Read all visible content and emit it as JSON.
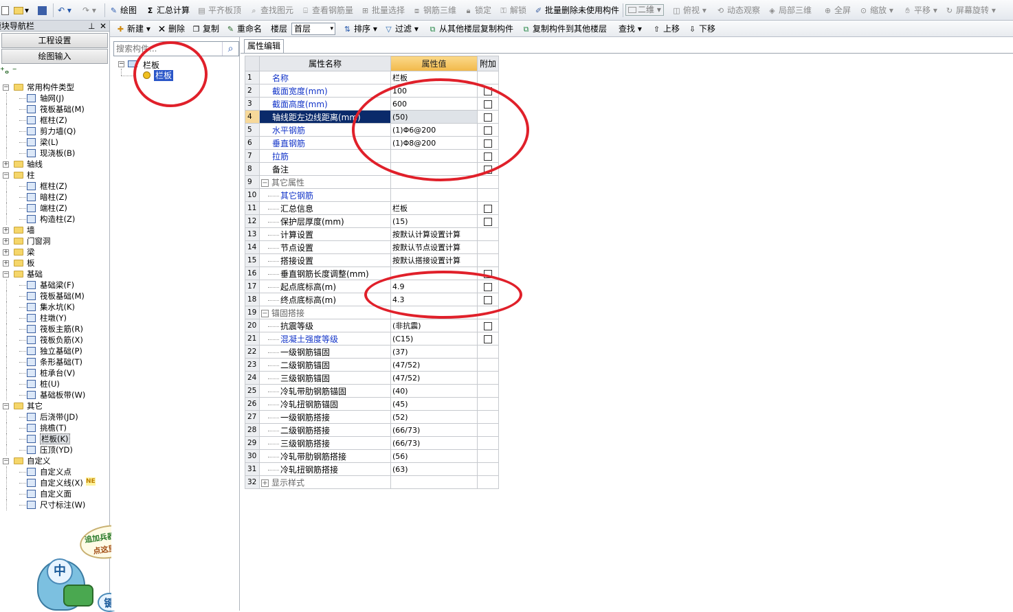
{
  "toolbar": {
    "draw": "绘图",
    "sum_calc": "汇总计算",
    "align_top": "平齐板顶",
    "find_element": "查找图元",
    "view_rebar": "查看钢筋量",
    "batch_select": "批量选择",
    "rebar_3d": "钢筋三维",
    "lock": "锁定",
    "unlock": "解锁",
    "batch_delete": "批量删除未使用构件",
    "view_mode": "二维",
    "top_view": "俯视",
    "dynamic_view": "动态观察",
    "local_3d": "局部三维",
    "fullscreen": "全屏",
    "zoom": "缩放",
    "pan": "平移",
    "rotate": "屏幕旋转"
  },
  "nav": {
    "title": "模块导航栏",
    "btn_project": "工程设置",
    "btn_draw": "绘图输入"
  },
  "tree": [
    {
      "label": "常用构件类型",
      "level": 0,
      "exp": "minus"
    },
    {
      "label": "轴网(J)",
      "level": 1
    },
    {
      "label": "筏板基础(M)",
      "level": 1
    },
    {
      "label": "框柱(Z)",
      "level": 1
    },
    {
      "label": "剪力墙(Q)",
      "level": 1
    },
    {
      "label": "梁(L)",
      "level": 1
    },
    {
      "label": "现浇板(B)",
      "level": 1
    },
    {
      "label": "轴线",
      "level": 0,
      "exp": "plus"
    },
    {
      "label": "柱",
      "level": 0,
      "exp": "minus"
    },
    {
      "label": "框柱(Z)",
      "level": 1
    },
    {
      "label": "暗柱(Z)",
      "level": 1
    },
    {
      "label": "端柱(Z)",
      "level": 1
    },
    {
      "label": "构造柱(Z)",
      "level": 1
    },
    {
      "label": "墙",
      "level": 0,
      "exp": "plus"
    },
    {
      "label": "门窗洞",
      "level": 0,
      "exp": "plus"
    },
    {
      "label": "梁",
      "level": 0,
      "exp": "plus"
    },
    {
      "label": "板",
      "level": 0,
      "exp": "plus"
    },
    {
      "label": "基础",
      "level": 0,
      "exp": "minus"
    },
    {
      "label": "基础梁(F)",
      "level": 1
    },
    {
      "label": "筏板基础(M)",
      "level": 1
    },
    {
      "label": "集水坑(K)",
      "level": 1
    },
    {
      "label": "柱墩(Y)",
      "level": 1
    },
    {
      "label": "筏板主筋(R)",
      "level": 1
    },
    {
      "label": "筏板负筋(X)",
      "level": 1
    },
    {
      "label": "独立基础(P)",
      "level": 1
    },
    {
      "label": "条形基础(T)",
      "level": 1
    },
    {
      "label": "桩承台(V)",
      "level": 1
    },
    {
      "label": "桩(U)",
      "level": 1
    },
    {
      "label": "基础板带(W)",
      "level": 1
    },
    {
      "label": "其它",
      "level": 0,
      "exp": "minus"
    },
    {
      "label": "后浇带(JD)",
      "level": 1
    },
    {
      "label": "挑檐(T)",
      "level": 1
    },
    {
      "label": "栏板(K)",
      "level": 1,
      "selected": true
    },
    {
      "label": "压顶(YD)",
      "level": 1
    },
    {
      "label": "自定义",
      "level": 0,
      "exp": "minus"
    },
    {
      "label": "自定义点",
      "level": 1
    },
    {
      "label": "自定义线(X)",
      "level": 1,
      "badge": "NE"
    },
    {
      "label": "自定义面",
      "level": 1
    },
    {
      "label": "尺寸标注(W)",
      "level": 1
    }
  ],
  "bar2": {
    "new": "新建",
    "delete": "删除",
    "copy": "复制",
    "rename": "重命名",
    "floor_label": "楼层",
    "floor_value": "首层",
    "sort": "排序",
    "filter": "过滤",
    "copy_from_floor": "从其他楼层复制构件",
    "copy_to_floor": "复制构件到其他楼层",
    "find": "查找",
    "move_up": "上移",
    "move_down": "下移"
  },
  "mid": {
    "search_placeholder": "搜索构件...",
    "root": "栏板",
    "child": "栏板"
  },
  "props": {
    "tab": "属性编辑",
    "col_name": "属性名称",
    "col_value": "属性值",
    "col_extra": "附加",
    "rows": [
      {
        "n": "1",
        "name": "名称",
        "value": "栏板",
        "blue": true,
        "chk": false
      },
      {
        "n": "2",
        "name": "截面宽度(mm)",
        "value": "100",
        "blue": true,
        "chk": true
      },
      {
        "n": "3",
        "name": "截面高度(mm)",
        "value": "600",
        "blue": true,
        "chk": true
      },
      {
        "n": "4",
        "name": "轴线距左边线距离(mm)",
        "value": "(50)",
        "blue": false,
        "chk": true,
        "sel": true
      },
      {
        "n": "5",
        "name": "水平钢筋",
        "value": "(1)Φ6@200",
        "blue": true,
        "chk": true
      },
      {
        "n": "6",
        "name": "垂直钢筋",
        "value": "(1)Φ8@200",
        "blue": true,
        "chk": true
      },
      {
        "n": "7",
        "name": "拉筋",
        "value": "",
        "blue": true,
        "chk": true
      },
      {
        "n": "8",
        "name": "备注",
        "value": "",
        "blue": false,
        "chk": true
      },
      {
        "n": "9",
        "name": "其它属性",
        "value": "",
        "group": "minus"
      },
      {
        "n": "10",
        "name": "其它钢筋",
        "value": "",
        "blue": true,
        "indent": true
      },
      {
        "n": "11",
        "name": "汇总信息",
        "value": "栏板",
        "indent": true,
        "chk": true
      },
      {
        "n": "12",
        "name": "保护层厚度(mm)",
        "value": "(15)",
        "indent": true,
        "chk": true
      },
      {
        "n": "13",
        "name": "计算设置",
        "value": "按默认计算设置计算",
        "indent": true
      },
      {
        "n": "14",
        "name": "节点设置",
        "value": "按默认节点设置计算",
        "indent": true
      },
      {
        "n": "15",
        "name": "搭接设置",
        "value": "按默认搭接设置计算",
        "indent": true
      },
      {
        "n": "16",
        "name": "垂直钢筋长度调整(mm)",
        "value": "",
        "indent": true,
        "chk": true
      },
      {
        "n": "17",
        "name": "起点底标高(m)",
        "value": "4.9",
        "indent": true,
        "chk": true
      },
      {
        "n": "18",
        "name": "终点底标高(m)",
        "value": "4.3",
        "indent": true,
        "chk": true
      },
      {
        "n": "19",
        "name": "锚固搭接",
        "value": "",
        "group": "minus"
      },
      {
        "n": "20",
        "name": "抗震等级",
        "value": "(非抗震)",
        "indent": true,
        "chk": true
      },
      {
        "n": "21",
        "name": "混凝土强度等级",
        "value": "(C15)",
        "blue": true,
        "indent": true,
        "chk": true
      },
      {
        "n": "22",
        "name": "一级钢筋锚固",
        "value": "(37)",
        "indent": true
      },
      {
        "n": "23",
        "name": "二级钢筋锚固",
        "value": "(47/52)",
        "indent": true
      },
      {
        "n": "24",
        "name": "三级钢筋锚固",
        "value": "(47/52)",
        "indent": true
      },
      {
        "n": "25",
        "name": "冷轧带肋钢筋锚固",
        "value": "(40)",
        "indent": true
      },
      {
        "n": "26",
        "name": "冷轧扭钢筋锚固",
        "value": "(45)",
        "indent": true
      },
      {
        "n": "27",
        "name": "一级钢筋搭接",
        "value": "(52)",
        "indent": true
      },
      {
        "n": "28",
        "name": "二级钢筋搭接",
        "value": "(66/73)",
        "indent": true
      },
      {
        "n": "29",
        "name": "三级钢筋搭接",
        "value": "(66/73)",
        "indent": true
      },
      {
        "n": "30",
        "name": "冷轧带肋钢筋搭接",
        "value": "(56)",
        "indent": true
      },
      {
        "n": "31",
        "name": "冷轧扭钢筋搭接",
        "value": "(63)",
        "indent": true
      },
      {
        "n": "32",
        "name": "显示样式",
        "value": "",
        "group": "plus"
      }
    ]
  },
  "mascot": {
    "bubble_line1": "追加兵器法",
    "bubble_line2": "点这里...",
    "key1": "中",
    "key2": "键"
  },
  "colors": {
    "accent": "#f7c060",
    "annotation": "#e0202a",
    "selection": "#0a2a6a"
  }
}
